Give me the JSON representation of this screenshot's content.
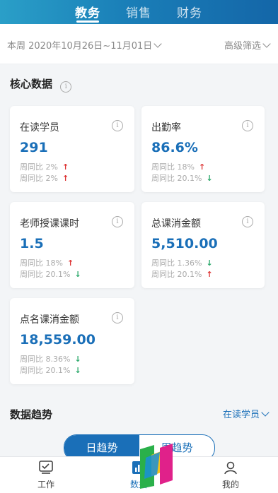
{
  "top_tabs": [
    {
      "label": "教务",
      "active": true
    },
    {
      "label": "销售",
      "active": false
    },
    {
      "label": "财务",
      "active": false
    }
  ],
  "filter": {
    "date_range": "本周 2020年10月26日~11月01日",
    "advanced": "高级筛选"
  },
  "core": {
    "title": "核心数据",
    "info_glyph": "i",
    "cards": [
      {
        "label": "在读学员",
        "value": "291",
        "cmp1": "周同比 2%",
        "cmp1_dir": "up",
        "cmp2": "周同比 2%",
        "cmp2_dir": "up"
      },
      {
        "label": "出勤率",
        "value": "86.6%",
        "cmp1": "周同比 18%",
        "cmp1_dir": "up",
        "cmp2": "周同比 20.1%",
        "cmp2_dir": "down"
      },
      {
        "label": "老师授课课时",
        "value": "1.5",
        "cmp1": "周同比 18%",
        "cmp1_dir": "up",
        "cmp2": "周同比 20.1%",
        "cmp2_dir": "down"
      },
      {
        "label": "总课消金额",
        "value": "5,510.00",
        "cmp1": "周同比 1.36%",
        "cmp1_dir": "down",
        "cmp2": "周同比 20.1%",
        "cmp2_dir": "up"
      },
      {
        "label": "点名课消金额",
        "value": "18,559.00",
        "cmp1": "周同比 8.36%",
        "cmp1_dir": "down",
        "cmp2": "周同比 20.1%",
        "cmp2_dir": "down"
      }
    ]
  },
  "trend": {
    "title": "数据趋势",
    "select": "在读学员",
    "seg_day": "日趋势",
    "seg_week": "周趋势"
  },
  "bottom_nav": [
    {
      "label": "工作",
      "icon": "work-icon"
    },
    {
      "label": "数据",
      "icon": "chart-icon"
    },
    {
      "label": "我的",
      "icon": "profile-icon"
    }
  ],
  "colors": {
    "accent": "#1a6fb8",
    "up": "#dd3333",
    "down": "#2aa86a"
  },
  "arrows": {
    "up": "↑",
    "down": "↓"
  }
}
